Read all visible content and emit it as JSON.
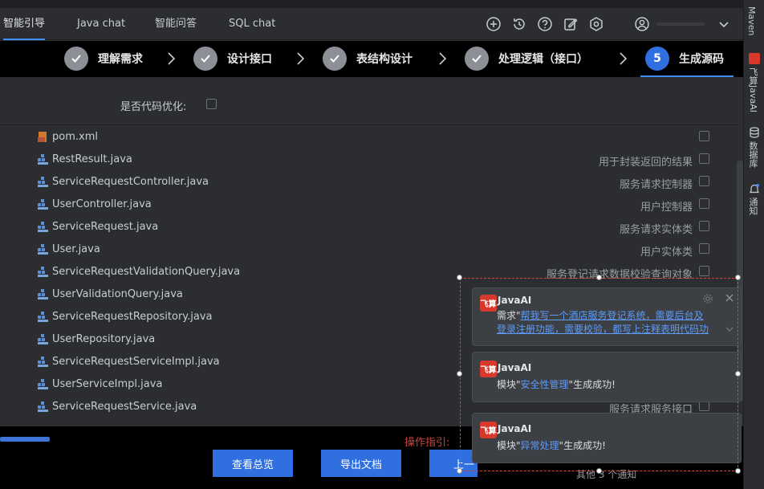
{
  "tabs": [
    {
      "label": "智能引导",
      "active": true
    },
    {
      "label": "Java chat",
      "active": false
    },
    {
      "label": "智能问答",
      "active": false
    },
    {
      "label": "SQL chat",
      "active": false
    }
  ],
  "toolbar_icons": [
    "add-icon",
    "history-icon",
    "help-icon",
    "edit-icon",
    "settings-icon",
    "user-icon",
    "chevron-down-icon"
  ],
  "steps": [
    {
      "label": "理解需求",
      "status": "done"
    },
    {
      "label": "设计接口",
      "status": "done"
    },
    {
      "label": "表结构设计",
      "status": "done"
    },
    {
      "label": "处理逻辑（接口）",
      "status": "done"
    },
    {
      "label": "生成源码",
      "status": "current",
      "number": "5"
    }
  ],
  "optimize_label": "是否代码优化:",
  "files": [
    {
      "name": "pom.xml",
      "desc": ""
    },
    {
      "name": "RestResult.java",
      "desc": "用于封装返回的结果"
    },
    {
      "name": "ServiceRequestController.java",
      "desc": "服务请求控制器"
    },
    {
      "name": "UserController.java",
      "desc": "用户控制器"
    },
    {
      "name": "ServiceRequest.java",
      "desc": "服务请求实体类"
    },
    {
      "name": "User.java",
      "desc": "用户实体类"
    },
    {
      "name": "ServiceRequestValidationQuery.java",
      "desc": "服务登记请求数据校验查询对象"
    },
    {
      "name": "UserValidationQuery.java",
      "desc": ""
    },
    {
      "name": "ServiceRequestRepository.java",
      "desc": ""
    },
    {
      "name": "UserRepository.java",
      "desc": ""
    },
    {
      "name": "ServiceRequestServiceImpl.java",
      "desc": ""
    },
    {
      "name": "UserServiceImpl.java",
      "desc": ""
    },
    {
      "name": "ServiceRequestService.java",
      "desc": "服务请求服务接口"
    }
  ],
  "buttons": {
    "overview": "查看总览",
    "export": "导出文档",
    "prev": "上一"
  },
  "guide_text": "操作指引:",
  "sidebar": {
    "maven": "Maven",
    "feisuan": "飞算JavaAI",
    "database": "数据库",
    "notify": "通知"
  },
  "notifications": [
    {
      "logo": "飞算",
      "title": "JavaAI",
      "prefix": "需求\"",
      "link": "帮我写一个酒店服务登记系统，需要后台及登录注册功能，需要校验，都写上注释表明代码功",
      "suffix": ""
    },
    {
      "logo": "飞算",
      "title": "JavaAI",
      "prefix": "模块\"",
      "link": "安全性管理",
      "suffix": "\"生成成功!"
    },
    {
      "logo": "飞算",
      "title": "JavaAI",
      "prefix": "模块\"",
      "link": "异常处理",
      "suffix": "\"生成成功!"
    }
  ],
  "more_notifications": "其他 3 个通知",
  "colors": {
    "accent": "#2f6fe0",
    "link": "#5e9bf7",
    "logo": "#d9392d",
    "selection": "#e0433a"
  }
}
